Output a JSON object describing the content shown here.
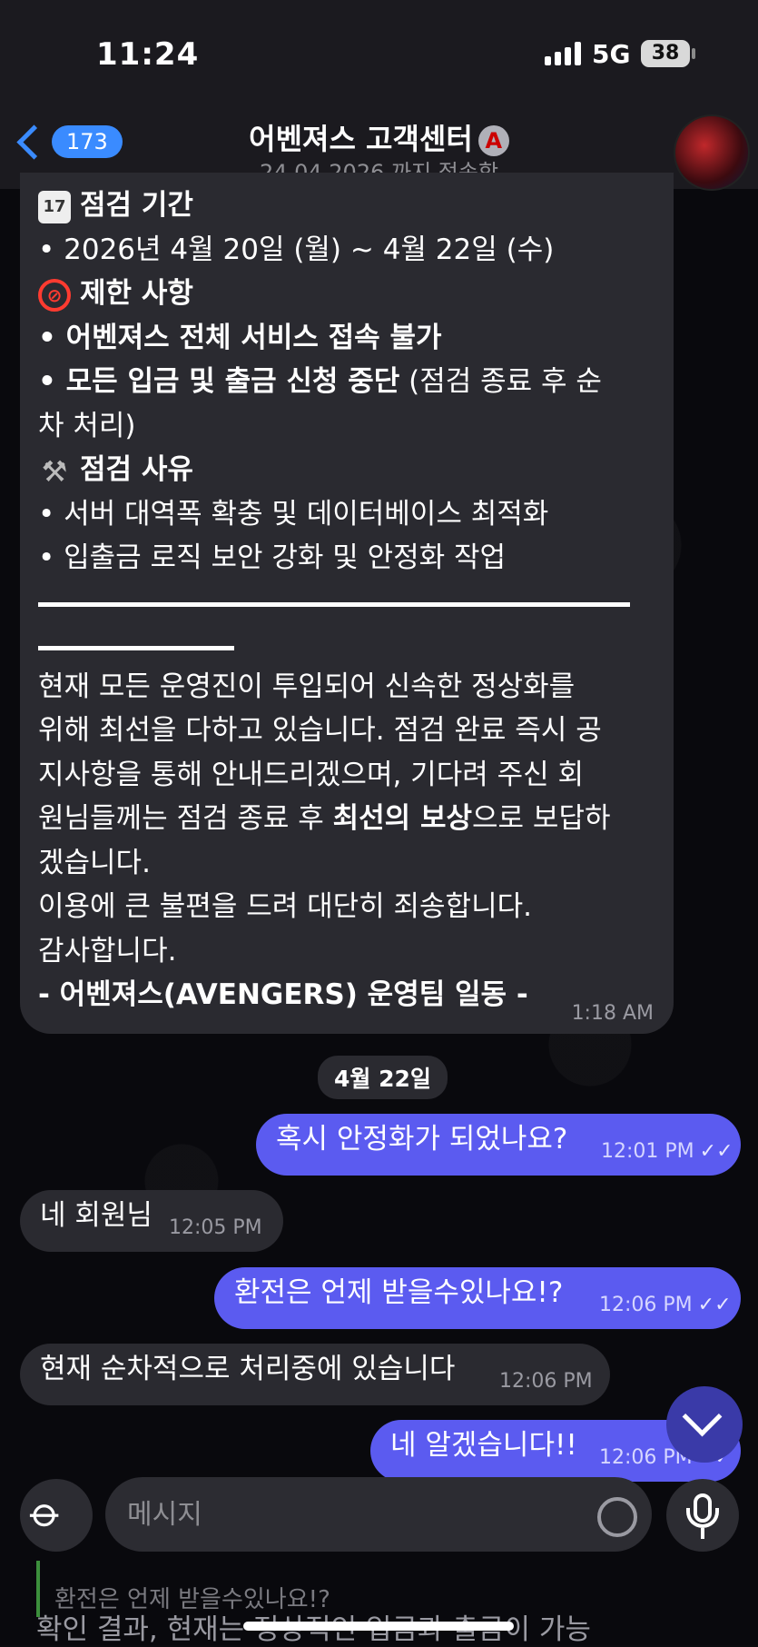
{
  "status_bar": {
    "time": "11:24",
    "network": "5G",
    "battery": "38"
  },
  "header": {
    "back_count": "173",
    "title": "어벤져스 고객센터",
    "subtitle": "24.04.2026.까지 접속함"
  },
  "big_message": {
    "maintenance_period_label": "점검 기간",
    "period_line": "• 2026년 4월 20일 (월) ~ 4월 22일 (수)",
    "restrictions_label": "제한 사항",
    "restriction_1": "• 어벤져스 전체 서비스 접속 불가",
    "restriction_2_bold": "• 모든 입금 및 출금 신청 중단",
    "restriction_2_rest": " (점검 종료 후 순",
    "restriction_2_cont": "차 처리)",
    "reason_label": "점검 사유",
    "reason_1": "• 서버 대역폭 확충 및 데이터베이스 최적화",
    "reason_2": "• 입출금 로직 보안 강화 및 안정화 작업",
    "body_1": "현재 모든 운영진이 투입되어 신속한 정상화를",
    "body_2": "위해 최선을 다하고 있습니다. 점검 완료 즉시 공",
    "body_3": "지사항을 통해 안내드리겠으며, 기다려 주신 회",
    "body_4a": "원님들께는 점검 종료 후 ",
    "body_4b": "최선의 보상",
    "body_4c": "으로 보답하",
    "body_5": "겠습니다.",
    "body_6": "이용에 큰 불편을 드려 대단히 죄송합니다.",
    "body_7": "감사합니다.",
    "signature": "- 어벤져스(AVENGERS) 운영팀 일동 -",
    "time": "1:18 AM"
  },
  "date_separator": "4월 22일",
  "messages": [
    {
      "text": "혹시 안정화가 되었나요?",
      "time": "12:01 PM"
    },
    {
      "text": "네 회원님",
      "time": "12:05 PM"
    },
    {
      "text": "환전은 언제 받을수있나요!?",
      "time": "12:06 PM"
    },
    {
      "text": "현재 순차적으로 처리중에 있습니다",
      "time": "12:06 PM"
    },
    {
      "text": "네 알겠습니다!!",
      "time": "12:06 PM"
    }
  ],
  "input": {
    "placeholder": "메시지"
  },
  "reply_preview": {
    "quoted": "환전은 언제 받을수있나요!?"
  },
  "bottom_text": "확인 결과, 현재는 정상적인 입금과 출금이 가능"
}
